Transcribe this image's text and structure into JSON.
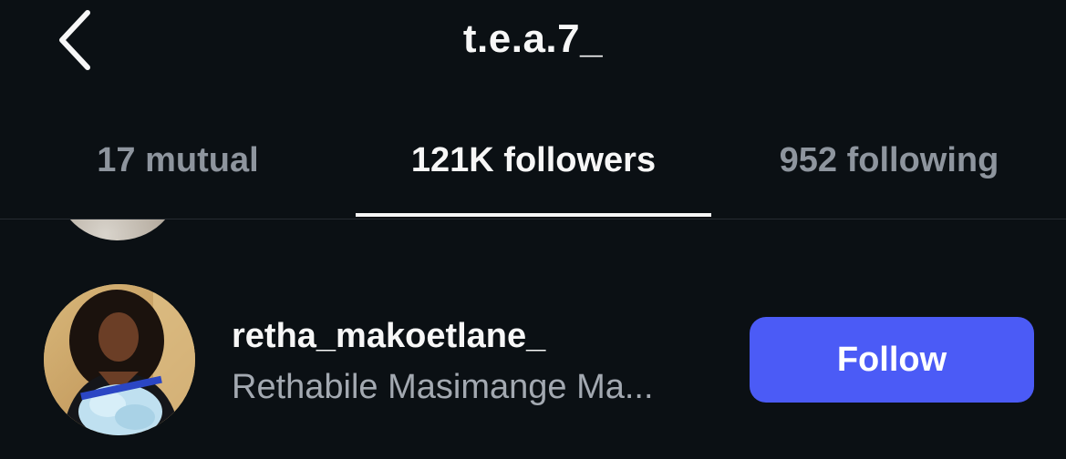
{
  "header": {
    "title": "t.e.a.7_",
    "back_icon": "chevron-left-icon"
  },
  "tabs": [
    {
      "label": "17 mutual",
      "active": false
    },
    {
      "label": "121K followers",
      "active": true
    },
    {
      "label": "952 following",
      "active": false
    }
  ],
  "colors": {
    "background": "#0b1014",
    "active_text": "#f7f7f7",
    "inactive_text": "#8e959e",
    "accent": "#4b5bf6",
    "subtext": "#a3a9b1"
  },
  "list": {
    "items": [
      {
        "username": "retha_makoetlane_",
        "full_name": "Rethabile Masimange Ma...",
        "button_label": "Follow"
      }
    ]
  }
}
